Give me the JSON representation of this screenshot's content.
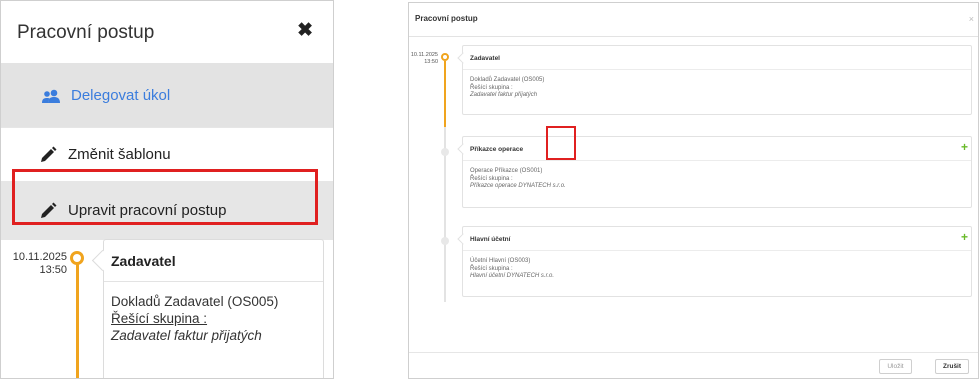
{
  "left": {
    "title": "Pracovní postup",
    "close_glyph": "✖",
    "menu": {
      "delegate": "Delegovat úkol",
      "change_template": "Změnit šablonu",
      "edit_workflow": "Upravit pracovní postup"
    },
    "timeline": {
      "date": "10.11.2025",
      "time": "13:50",
      "card": {
        "title": "Zadavatel",
        "line1": "Dokladů Zadavatel (OS005)",
        "line2": "Řešící skupina :",
        "line3": "Zadavatel faktur přijatých"
      }
    }
  },
  "right": {
    "title": "Pracovní postup",
    "close_glyph": "×",
    "date": "10.11.2025",
    "time": "13:50",
    "cards": [
      {
        "title": "Zadavatel",
        "line1": "Dokladů Zadavatel (OS005)",
        "line2": "Řešící skupina :",
        "line3": "Zadavatel faktur přijatých"
      },
      {
        "title": "Příkazce operace",
        "line1": "Operace Příkazce (OS001)",
        "line2": "Řešící skupina :",
        "line3": "Příkazce operace DYNATECH s.r.o."
      },
      {
        "title": "Hlavní účetní",
        "line1": "Účetní Hlavní (OS003)",
        "line2": "Řešící skupina :",
        "line3": "Hlavní účetní DYNATECH s.r.o."
      }
    ],
    "plus_glyph": "+",
    "footer": {
      "save": "Uložit",
      "cancel": "Zrušit"
    }
  },
  "colors": {
    "accent_orange": "#f0a41e",
    "highlight_red": "#e02020",
    "link_blue": "#3b7ddd",
    "plus_green": "#6aba2a"
  },
  "icons": [
    "user-group-icon",
    "pencil-icon",
    "close-icon",
    "plus-icon"
  ]
}
